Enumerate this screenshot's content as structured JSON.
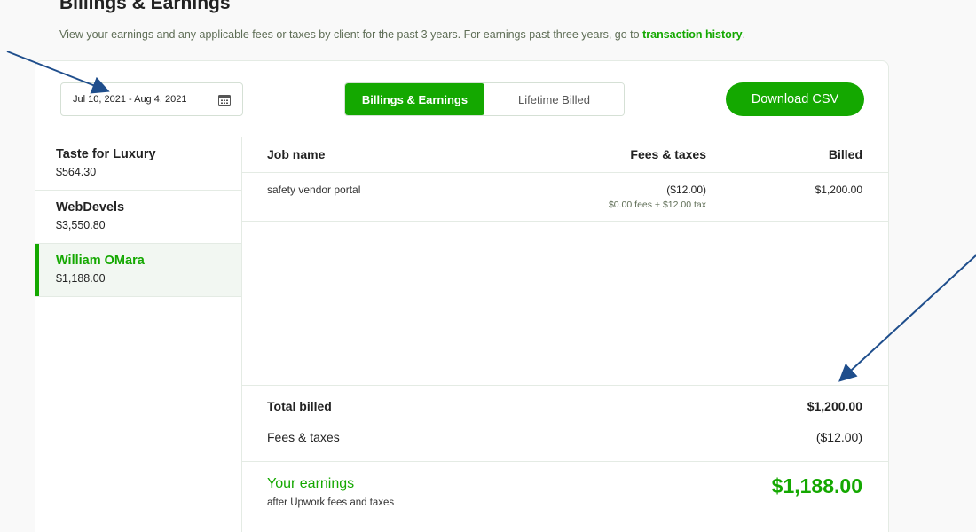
{
  "header": {
    "title": "Billings & Earnings",
    "description": "View your earnings and any applicable fees or taxes by client for the past 3 years. For earnings past three years, go to",
    "link_text": "transaction history",
    "trailing": "."
  },
  "toolbar": {
    "date_range": "Jul 10, 2021 - Aug 4, 2021",
    "date_icon": "calendar-icon",
    "tabs": [
      {
        "label": "Billings & Earnings",
        "active": true
      },
      {
        "label": "Lifetime Billed",
        "active": false
      }
    ],
    "download_label": "Download CSV"
  },
  "clients": [
    {
      "name": "Taste for Luxury",
      "amount": "$564.30",
      "active": false
    },
    {
      "name": "WebDevels",
      "amount": "$3,550.80",
      "active": false
    },
    {
      "name": "William OMara",
      "amount": "$1,188.00",
      "active": true
    }
  ],
  "table": {
    "headers": {
      "job": "Job name",
      "fees": "Fees & taxes",
      "billed": "Billed"
    },
    "rows": [
      {
        "job": "safety vendor portal",
        "fees": "($12.00)",
        "fees_detail": "$0.00 fees + $12.00 tax",
        "billed": "$1,200.00"
      }
    ]
  },
  "totals": {
    "billed_label": "Total billed",
    "billed_value": "$1,200.00",
    "fees_label": "Fees & taxes",
    "fees_value": "($12.00)"
  },
  "earnings": {
    "label": "Your earnings",
    "sublabel": "after Upwork fees and taxes",
    "value": "$1,188.00"
  },
  "colors": {
    "accent": "#14a800",
    "annotation_arrow": "#1f4e8c"
  }
}
